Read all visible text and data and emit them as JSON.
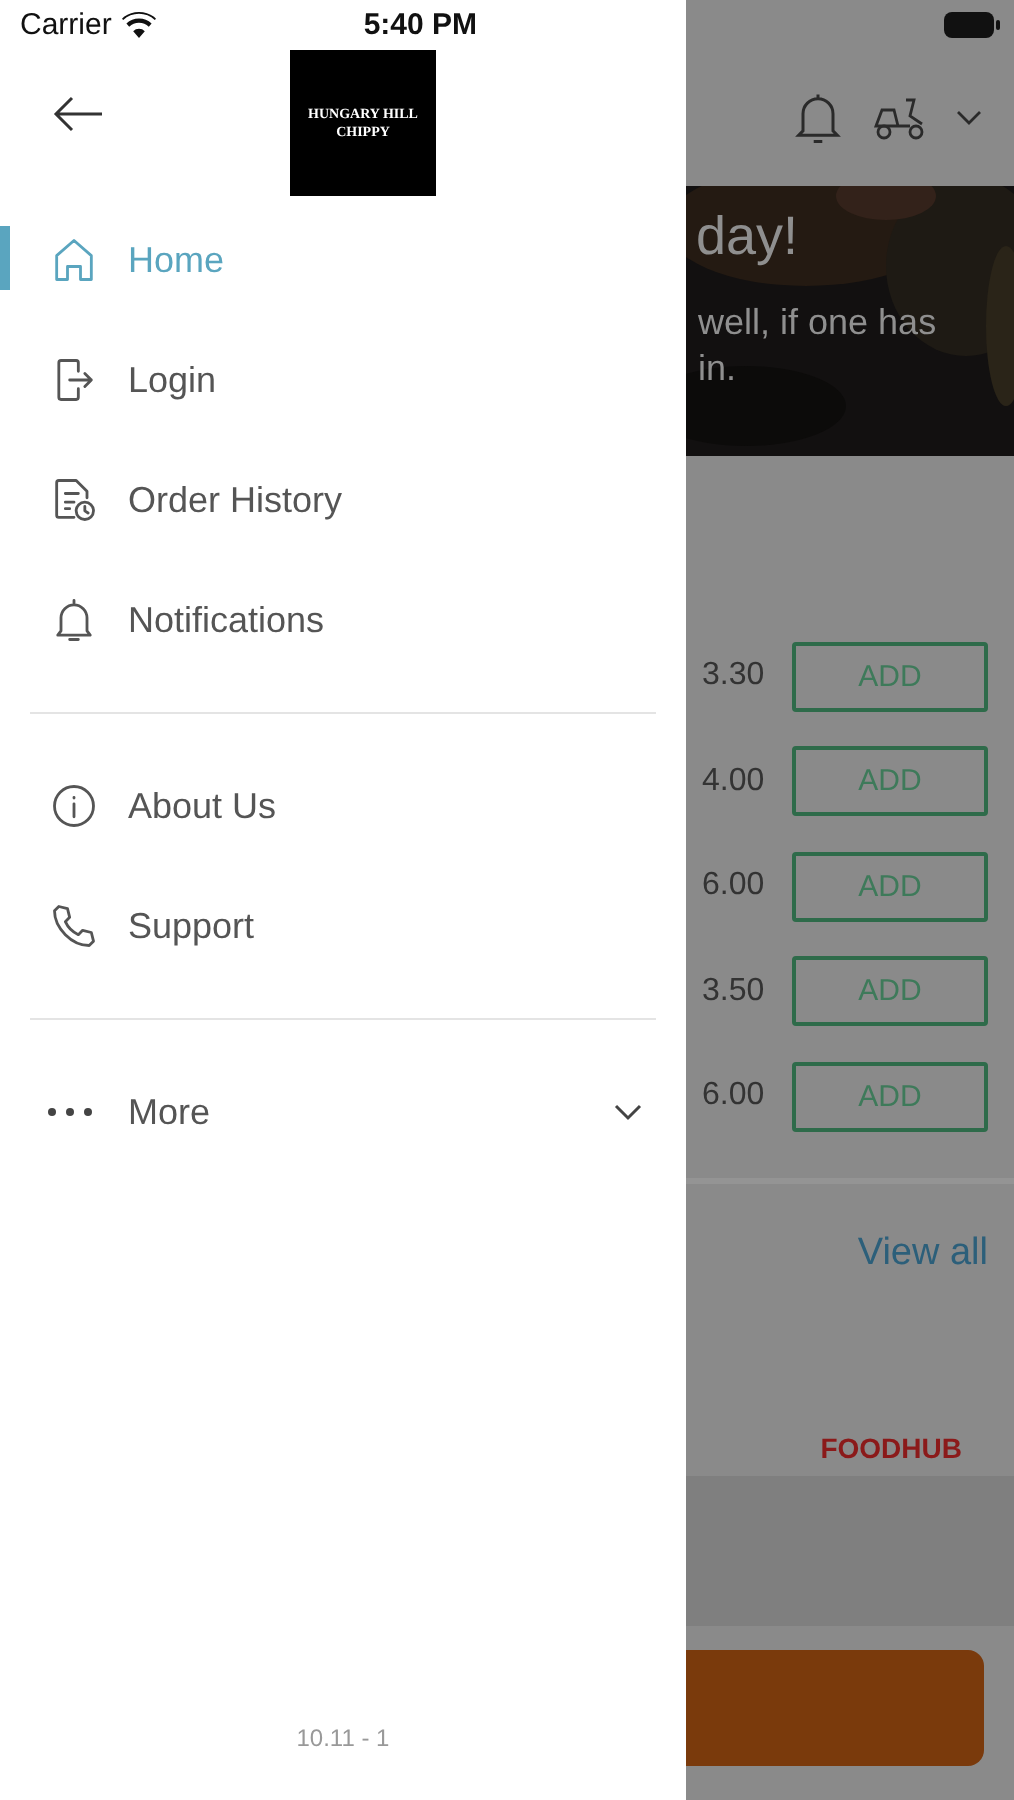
{
  "status_bar": {
    "carrier": "Carrier",
    "time": "5:40 PM"
  },
  "drawer": {
    "logo_text": "HUNGARY HILL CHIPPY",
    "menu_groups": [
      [
        {
          "label": "Home",
          "selected": true
        },
        {
          "label": "Login",
          "selected": false
        },
        {
          "label": "Order History",
          "selected": false
        },
        {
          "label": "Notifications",
          "selected": false
        }
      ],
      [
        {
          "label": "About Us",
          "selected": false
        },
        {
          "label": "Support",
          "selected": false
        }
      ]
    ],
    "more": {
      "label": "More",
      "expanded": false
    },
    "version": "10.11 - 1"
  },
  "background": {
    "hero": {
      "title": "day!",
      "lines": [
        "well, if one has",
        "in."
      ]
    },
    "items": [
      {
        "price": "3.30",
        "button": "ADD"
      },
      {
        "price": "4.00",
        "button": "ADD"
      },
      {
        "price": "6.00",
        "button": "ADD"
      },
      {
        "price": "3.50",
        "button": "ADD"
      },
      {
        "price": "6.00",
        "button": "ADD"
      }
    ],
    "view_all": "View all",
    "brand": "FOODHUB"
  }
}
